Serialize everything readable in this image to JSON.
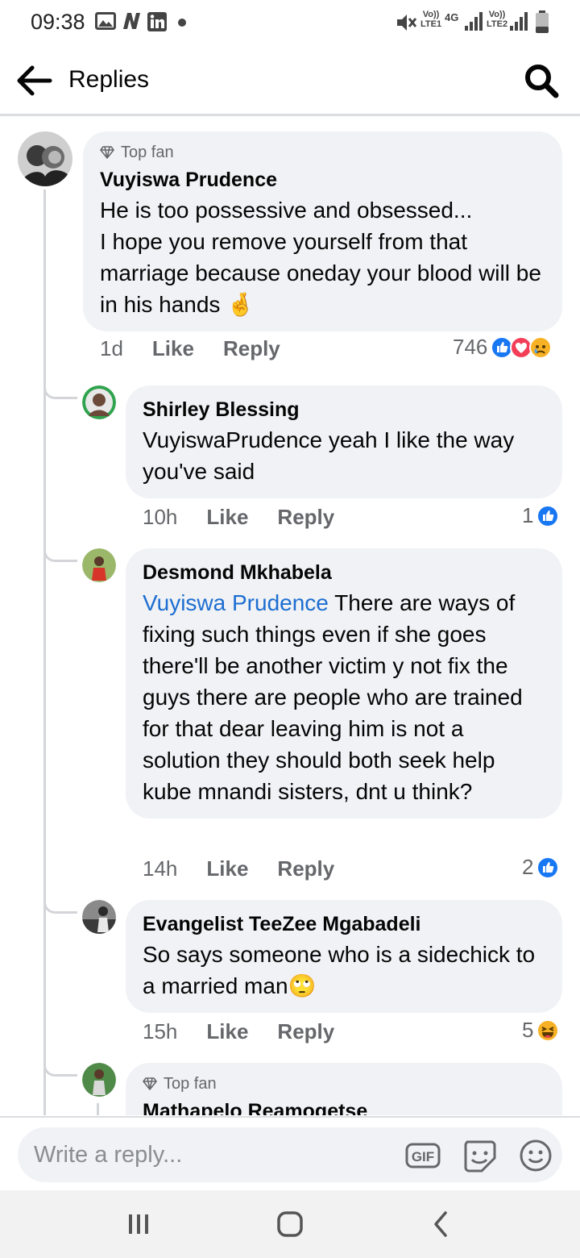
{
  "status_bar": {
    "time": "09:38",
    "network_labels": [
      "Vo)) LTE1",
      "4G",
      "Vo)) LTE2"
    ],
    "icons": [
      "gallery-icon",
      "app-n-icon",
      "linkedin-icon",
      "dot-icon",
      "mute-icon",
      "signal-icon",
      "battery-icon"
    ]
  },
  "header": {
    "back_icon": "arrow-left-icon",
    "title": "Replies",
    "search_icon": "search-icon"
  },
  "comments": [
    {
      "badge": "Top fan",
      "author": "Vuyiswa Prudence",
      "text": "He is too possessive and obsessed...\nI hope you remove yourself from that marriage because oneday your blood will be in his hands 🤞",
      "time": "1d",
      "like": "Like",
      "reply": "Reply",
      "reaction_count": "746",
      "reactions": [
        "like-reaction-icon",
        "love-reaction-icon",
        "sad-reaction-icon"
      ]
    },
    {
      "author": "Shirley Blessing",
      "text": "VuyiswaPrudence yeah I like the way you've said",
      "time": "10h",
      "like": "Like",
      "reply": "Reply",
      "reaction_count": "1",
      "reactions": [
        "like-reaction-icon"
      ]
    },
    {
      "author": "Desmond Mkhabela",
      "mention": "Vuyiswa Prudence",
      "text": " There are ways of fixing such things even if she goes there'll be another victim y not fix the guys there are people who are trained for that dear leaving him is  not a solution they should both seek help kube mnandi sisters, dnt u think?",
      "time": "14h",
      "like": "Like",
      "reply": "Reply",
      "reaction_count": "2",
      "reactions": [
        "like-reaction-icon"
      ]
    },
    {
      "author": "Evangelist TeeZee Mgabadeli",
      "text": "So says someone who is a sidechick to a married man🙄",
      "time": "15h",
      "like": "Like",
      "reply": "Reply",
      "reaction_count": "5",
      "reactions": [
        "haha-reaction-icon"
      ]
    },
    {
      "badge": "Top fan",
      "author": "Mathapelo Reamogetse"
    }
  ],
  "composer": {
    "placeholder": "Write a reply...",
    "icons": [
      "gif-icon",
      "sticker-icon",
      "emoji-icon"
    ]
  },
  "navbar": {
    "icons": [
      "recent-apps-icon",
      "home-icon",
      "back-nav-icon"
    ]
  },
  "colors": {
    "accent": "#1877f2",
    "mention": "#1d6ed1",
    "bubble": "#f0f2f5",
    "secondary_text": "#65676b"
  }
}
